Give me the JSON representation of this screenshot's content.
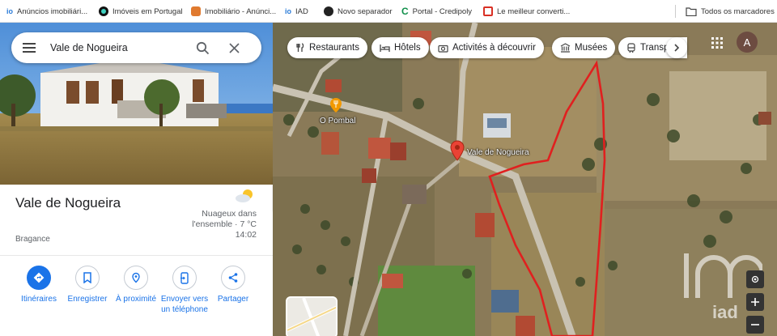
{
  "bookmarks": [
    {
      "label": "Anúncios imobiliári...",
      "icon": "iad-icon",
      "color": "#2a7bd8"
    },
    {
      "label": "Imóveis em Portugal",
      "icon": "imoveis-icon",
      "color": "#111111"
    },
    {
      "label": "Imobiliário - Anúnci...",
      "icon": "house-box-icon",
      "color": "#e07a2f"
    },
    {
      "label": "IAD",
      "icon": "iad-icon",
      "color": "#2a7bd8"
    },
    {
      "label": "Novo separador",
      "icon": "globe-icon",
      "color": "#222222"
    },
    {
      "label": "Portal - Credipoly",
      "icon": "credipoly-icon",
      "color": "#0f8f4a"
    },
    {
      "label": "Le meilleur converti...",
      "icon": "converter-icon",
      "color": "#d93025"
    }
  ],
  "bookmarks_folder": "Todos os marcadores",
  "search": {
    "value": "Vale de Nogueira"
  },
  "place": {
    "title": "Vale de Nogueira",
    "region": "Bragance",
    "weather_line1": "Nuageux dans",
    "weather_line2": "l'ensemble · 7 °C",
    "time": "14:02"
  },
  "actions": [
    {
      "label": "Itinéraires",
      "icon": "directions-icon"
    },
    {
      "label": "Enregistrer",
      "icon": "bookmark-icon"
    },
    {
      "label": "À proximité",
      "icon": "nearby-icon"
    },
    {
      "label": "Envoyer vers",
      "label2": "un téléphone",
      "icon": "send-to-phone-icon"
    },
    {
      "label": "Partager",
      "icon": "share-icon"
    }
  ],
  "map": {
    "chips": [
      "Restaurants",
      "Hôtels",
      "Activités à découvrir",
      "Musées",
      "Transp"
    ],
    "pin_label": "Vale de Nogueira",
    "poi_label": "O Pombal",
    "avatar_letter": "A",
    "watermark": "iad",
    "accent_color": "#1a73e8",
    "boundary_color": "#e0201f"
  }
}
